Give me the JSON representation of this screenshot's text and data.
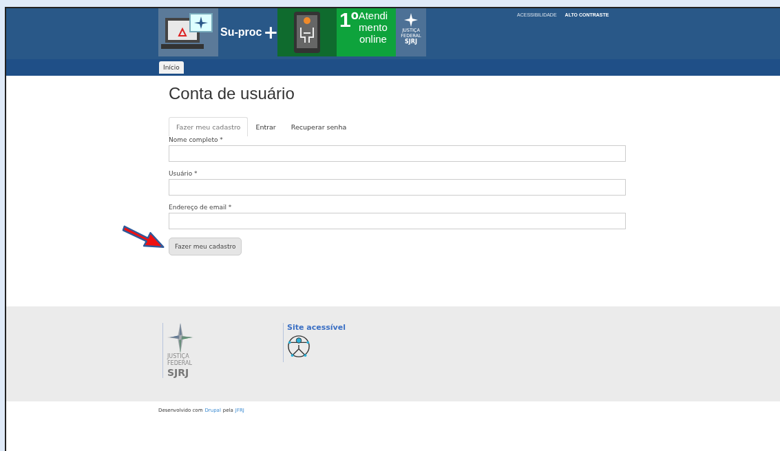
{
  "header": {
    "banner": {
      "title": "Su-proc",
      "plus": "+",
      "ordinal": "1º",
      "campaign_lines": [
        "Atendi",
        "mento",
        "online"
      ],
      "logo_lines": [
        "JUSTIÇA",
        "FEDERAL",
        "SJRJ"
      ]
    },
    "top_links": [
      "ACESSIBILIDADE",
      "ALTO CONTRASTE"
    ]
  },
  "nav": {
    "items": [
      {
        "label": "Início",
        "selected": true
      }
    ]
  },
  "page_title": "Conta de usuário",
  "tabs": [
    {
      "label": "Fazer meu cadastro",
      "selected": true
    },
    {
      "label": "Entrar",
      "selected": false
    },
    {
      "label": "Recuperar senha",
      "selected": false
    }
  ],
  "fields": [
    {
      "label": "Nome completo *"
    },
    {
      "label": "Usuário *"
    },
    {
      "label": "Endereço de email *"
    }
  ],
  "submit": "Fazer meu cadastro",
  "footer": {
    "logo_lines": [
      "JUSTIÇA",
      "FEDERAL",
      "SJRJ"
    ],
    "accessible_title": "Site acessível"
  },
  "credits": {
    "prefix": "Desenvolvido com",
    "link1": "Drupal",
    "middle": "pela",
    "link2": "JFRJ"
  }
}
